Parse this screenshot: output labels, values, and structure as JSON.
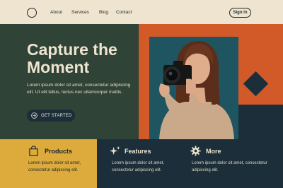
{
  "header": {
    "logo_icon": "circle-logo-icon",
    "nav": [
      "About",
      "Services",
      "Blog",
      "Contact"
    ],
    "signin_label": "Sign In"
  },
  "hero": {
    "headline_line1": "Capture the",
    "headline_line2": "Moment",
    "body": "Lorem ipsum dolor sit amet, consectetur adipiscing elit. Ut elit tellus, luctus nec ullamcorper mattis.",
    "cta_label": "GET STARTED",
    "cta_icon": "arrow-circle-icon",
    "image_icon": "woman-with-camera-photo"
  },
  "cards": [
    {
      "icon": "shopping-bag-icon",
      "title": "Products",
      "text": "Lorem ipsum dolor sit amet, consectetur adipiscing elit."
    },
    {
      "icon": "sparkle-icon",
      "title": "Features",
      "text": "Lorem ipsum dolor sit amet, consectetur adipiscing elit."
    },
    {
      "icon": "gear-icon",
      "title": "More",
      "text": "Lorem ipsum dolor sit amet, consectetur adipiscing elit."
    }
  ],
  "colors": {
    "cream": "#efe4cf",
    "forest": "#2f4336",
    "orange": "#d25a29",
    "navy": "#1b2e3a",
    "mustard": "#ddab3c",
    "teal": "#1e5560"
  }
}
